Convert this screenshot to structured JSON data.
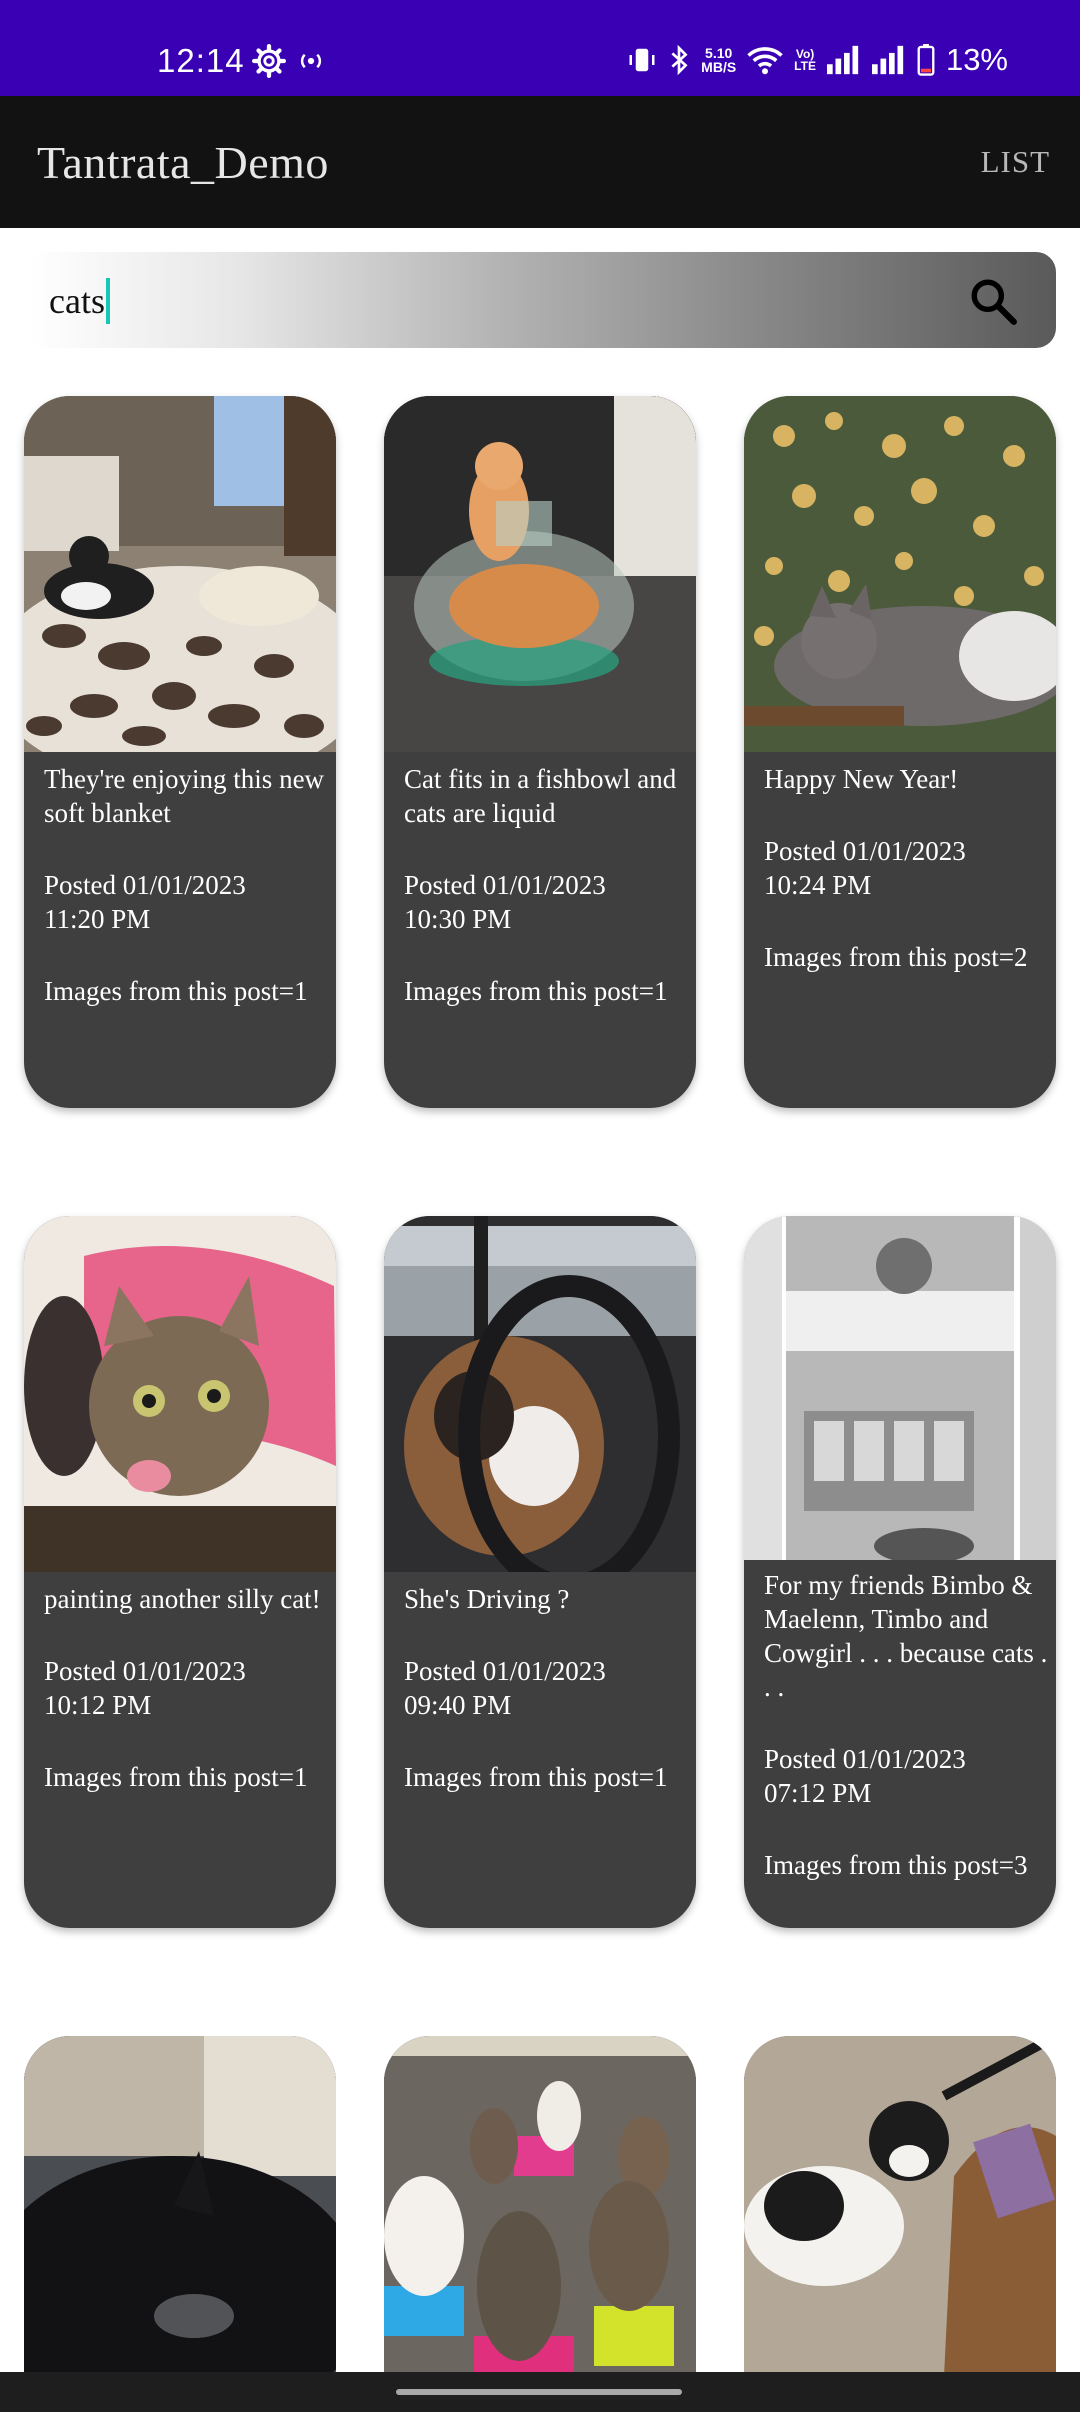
{
  "status": {
    "time": "12:14",
    "net_speed_value": "5.10",
    "net_speed_unit": "MB/S",
    "volte_line1": "Vo)",
    "volte_line2": "LTE",
    "battery": "13%"
  },
  "app": {
    "title": "Tantrata_Demo",
    "list_label": "LIST"
  },
  "search": {
    "value": "cats"
  },
  "posts": [
    {
      "title": "They're enjoying this new soft blanket",
      "posted": "Posted 01/01/2023",
      "time": "11:20 PM",
      "images": "Images from this post=1",
      "image_icon": "cat-blanket-photo"
    },
    {
      "title": "Cat fits in a fishbowl and cats are liquid",
      "posted": "Posted 01/01/2023",
      "time": "10:30 PM",
      "images": "Images from this post=1",
      "image_icon": "cat-fishbowl-photo"
    },
    {
      "title": "Happy New Year!",
      "posted": "Posted 01/01/2023",
      "time": "10:24 PM",
      "images": "Images from this post=2",
      "image_icon": "cat-christmas-lights-photo"
    },
    {
      "title": "painting another silly cat!",
      "posted": "Posted 01/01/2023",
      "time": "10:12 PM",
      "images": "Images from this post=1",
      "image_icon": "cat-painting-photo"
    },
    {
      "title": "She's Driving ?",
      "posted": "Posted 01/01/2023",
      "time": "09:40 PM",
      "images": "Images from this post=1",
      "image_icon": "cat-steering-wheel-photo"
    },
    {
      "title": "For my friends Bimbo & Maelenn, Timbo and Cowgirl . . . because cats . . .",
      "posted": "Posted 01/01/2023",
      "time": "07:12 PM",
      "images": "Images from this post=3",
      "image_icon": "cat-on-air-conditioner-photo"
    },
    {
      "image_icon": "black-cat-sleeping-photo"
    },
    {
      "image_icon": "cats-on-stools-photo"
    },
    {
      "image_icon": "cat-with-bag-photo"
    }
  ],
  "colors": {
    "status_bar": "#3a00b4",
    "app_bar": "#121212",
    "card_bg": "#3f3f3f",
    "caret": "#18c6b6"
  }
}
